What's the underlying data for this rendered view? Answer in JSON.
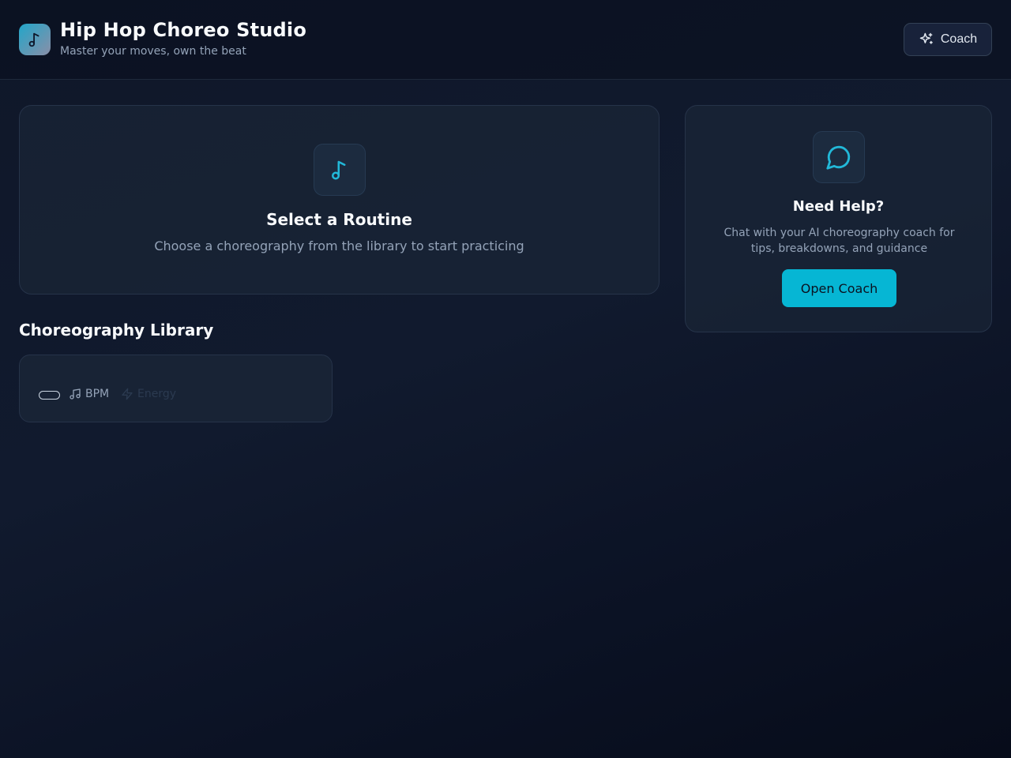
{
  "header": {
    "title": "Hip Hop Choreo Studio",
    "subtitle": "Master your moves, own the beat",
    "logo_icon": "music-note-icon",
    "coach_button": {
      "label": "Coach",
      "icon": "sparkles-icon"
    }
  },
  "routine_panel": {
    "icon": "music-note-icon",
    "title": "Select a Routine",
    "description": "Choose a choreography from the library to start practicing"
  },
  "help_panel": {
    "icon": "chat-bubble-icon",
    "title": "Need Help?",
    "description": "Chat with your AI choreography coach for tips, breakdowns, and guidance",
    "button_label": "Open Coach"
  },
  "library": {
    "title": "Choreography Library",
    "items": [
      {
        "bpm_label": "BPM",
        "energy_label": "Energy"
      }
    ]
  },
  "colors": {
    "accent": "#06b6d4",
    "background": "#0f1729",
    "card": "#1e293b",
    "muted_text": "#94a3b8"
  }
}
